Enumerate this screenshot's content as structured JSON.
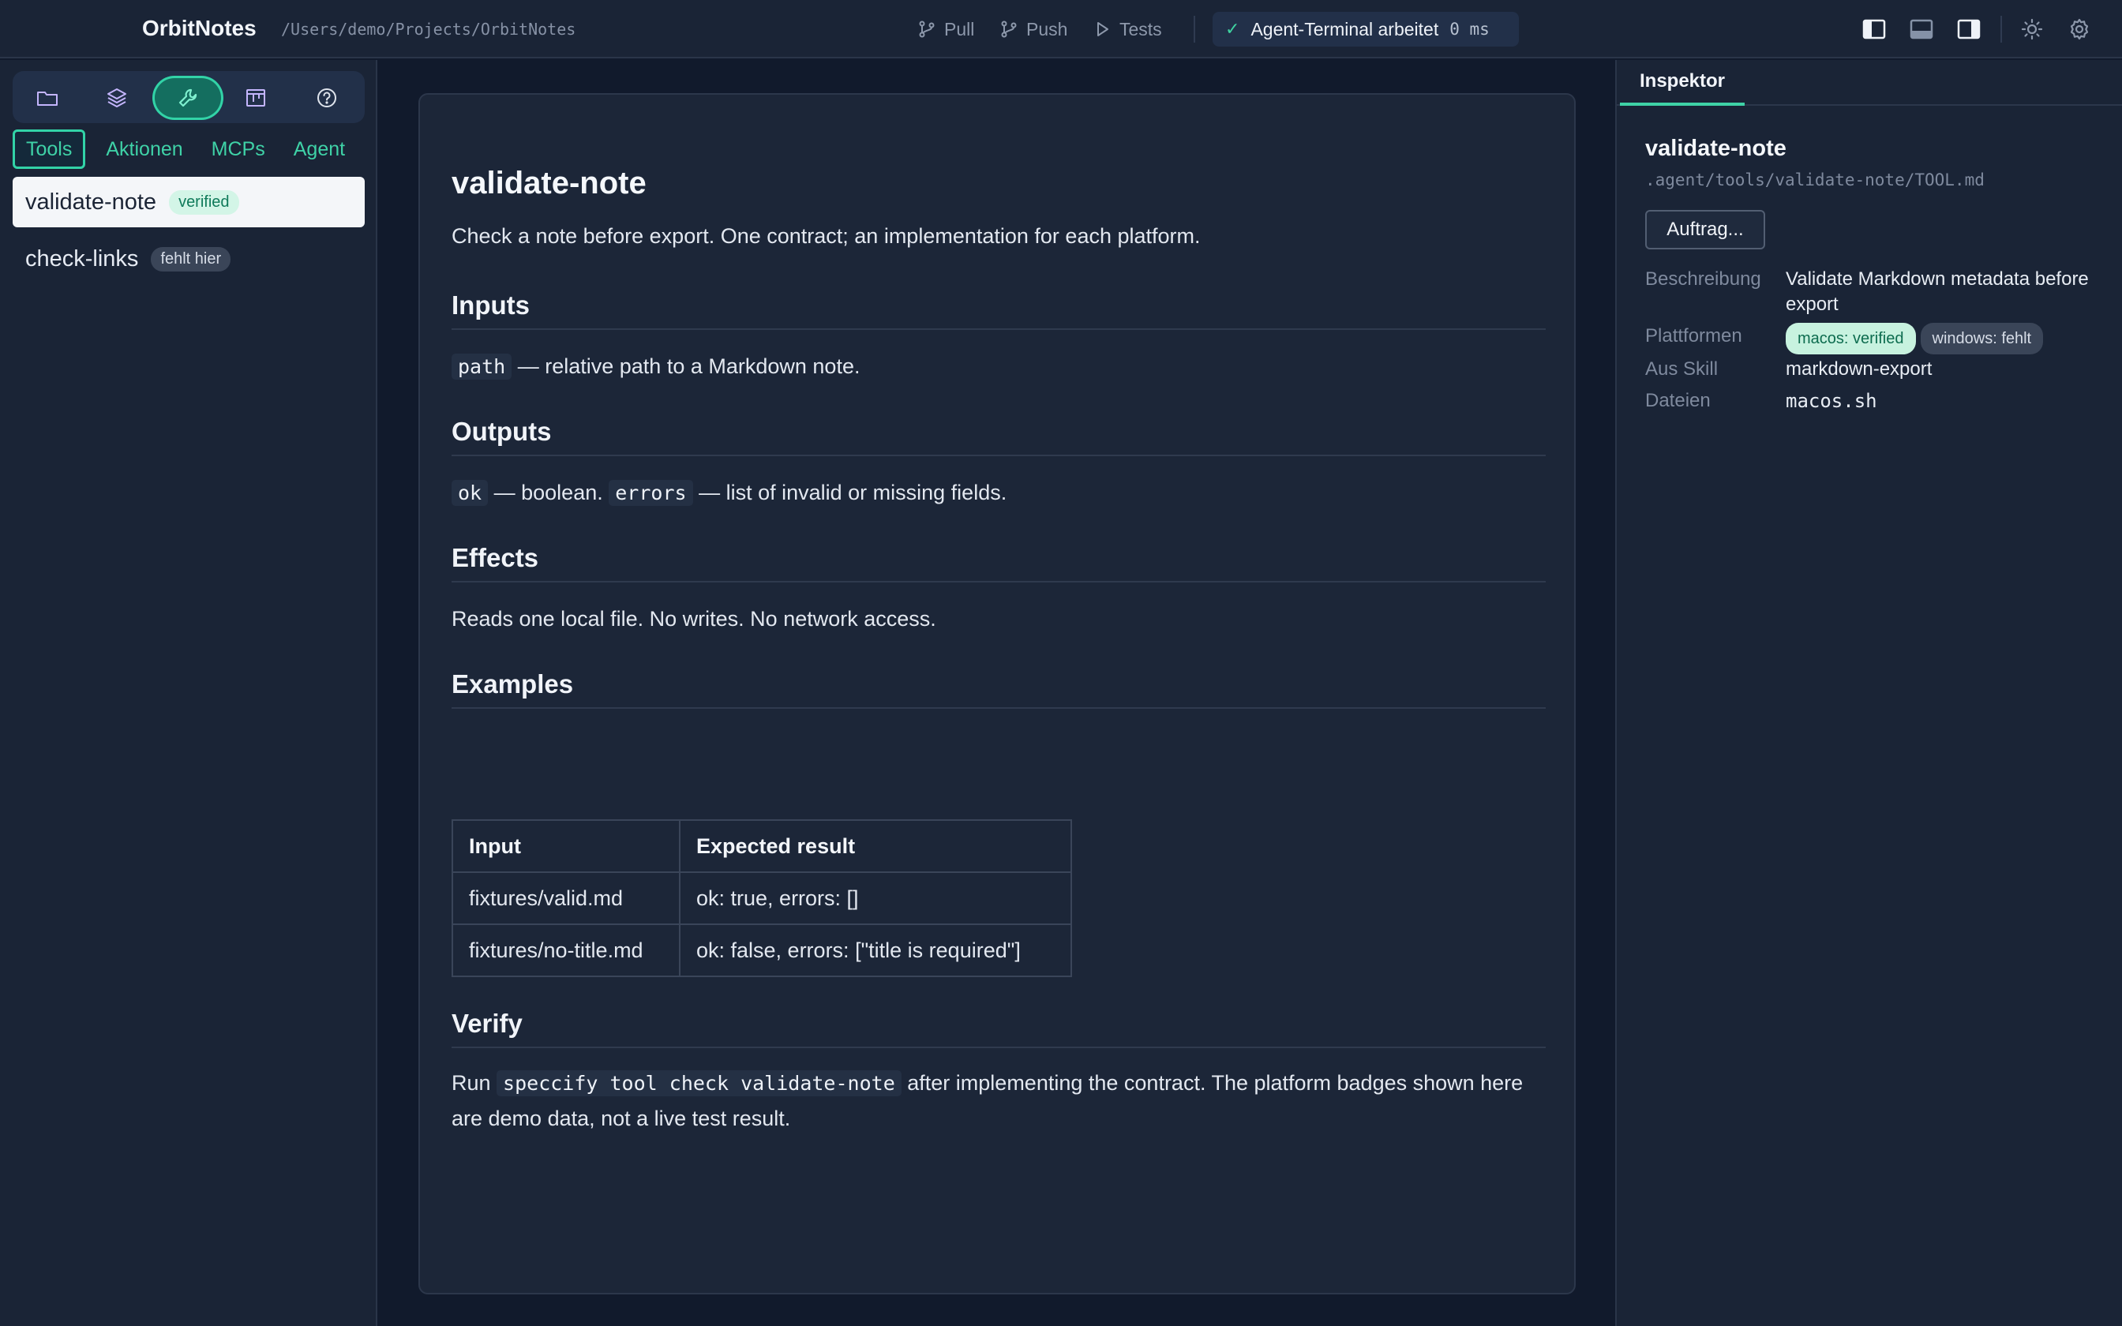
{
  "app": {
    "name": "OrbitNotes",
    "path": "/Users/demo/Projects/OrbitNotes"
  },
  "toolbar": {
    "pull_label": "Pull",
    "push_label": "Push",
    "tests_label": "Tests",
    "status_text": "Agent-Terminal arbeitet",
    "status_ms": "0 ms",
    "icons": [
      "branch-icon",
      "branch-icon",
      "play-icon",
      "check-icon",
      "layout-left-icon",
      "layout-bottom-icon",
      "layout-right-icon",
      "sun-icon",
      "gear-icon"
    ]
  },
  "sidebar": {
    "rail_icons": [
      "folder-icon",
      "layers-icon",
      "wrench-icon",
      "kanban-icon",
      "help-icon"
    ],
    "tabs": [
      "Tools",
      "Aktionen",
      "MCPs",
      "Agent"
    ],
    "items": [
      {
        "name": "validate-note",
        "badge": "verified"
      },
      {
        "name": "check-links",
        "badge": "fehlt hier"
      }
    ]
  },
  "doc": {
    "title": "validate-note",
    "lead": "Check a note before export. One contract; an implementation for each platform.",
    "inputs_heading": "Inputs",
    "inputs_code": "path",
    "inputs_text": "— relative path to a Markdown note.",
    "outputs_heading": "Outputs",
    "outputs_code1": "ok",
    "outputs_text1": "— boolean.",
    "outputs_code2": "errors",
    "outputs_text2": "— list of invalid or missing fields.",
    "effects_heading": "Effects",
    "effects_text": "Reads one local file. No writes. No network access.",
    "examples_heading": "Examples",
    "examples_table": {
      "headers": [
        "Input",
        "Expected result"
      ],
      "rows": [
        [
          "fixtures/valid.md",
          "ok: true, errors: []"
        ],
        [
          "fixtures/no-title.md",
          "ok: false, errors: [\"title is required\"]"
        ]
      ]
    },
    "verify_heading": "Verify",
    "verify_pre": "Run",
    "verify_code": "speccify tool check validate-note",
    "verify_post": "after implementing the contract. The platform badges shown here are demo data, not a live test result."
  },
  "inspector": {
    "tab": "Inspektor",
    "title": "validate-note",
    "path": ".agent/tools/validate-note/TOOL.md",
    "button": "Auftrag...",
    "fields": {
      "description_label": "Beschreibung",
      "description_value": "Validate Markdown metadata before export",
      "platforms_label": "Plattformen",
      "platform_ok": "macos: verified",
      "platform_missing": "windows: fehlt",
      "skill_label": "Aus Skill",
      "skill_value": "markdown-export",
      "files_label": "Dateien",
      "files_value": "macos.sh"
    }
  },
  "colors": {
    "accent": "#32d3a7",
    "background": "#111a2c",
    "panel": "#1a2436"
  }
}
